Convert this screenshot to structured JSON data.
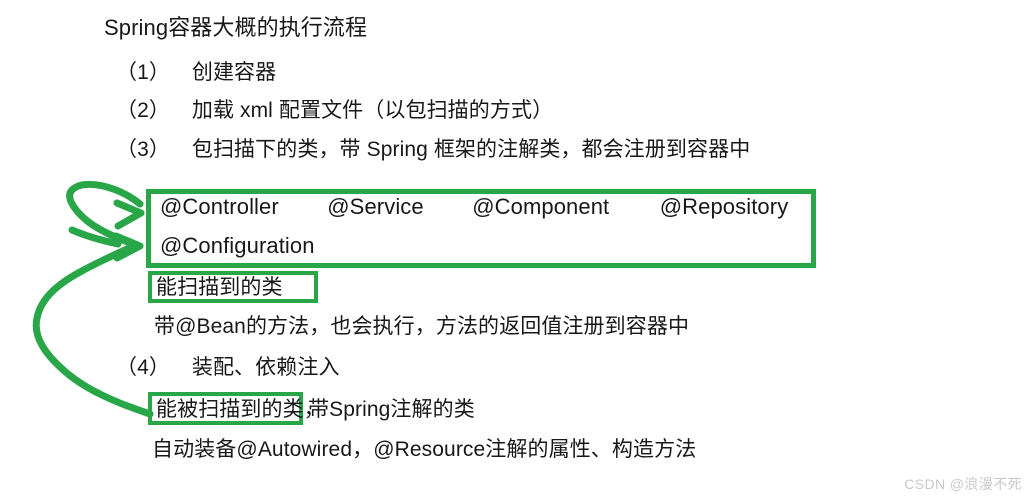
{
  "document": {
    "title": "Spring容器大概的执行流程",
    "steps": [
      {
        "marker": "（1）",
        "text": "创建容器"
      },
      {
        "marker": "（2）",
        "text": "加载 xml 配置文件（以包扫描的方式）"
      },
      {
        "marker": "（3）",
        "text": "包扫描下的类，带 Spring 框架的注解类，都会注册到容器中"
      },
      {
        "marker": "（4）",
        "text": "装配、依赖注入"
      }
    ],
    "annotation_box": {
      "row1": [
        "@Controller",
        "@Service",
        "@Component",
        "@Repository"
      ],
      "row2": [
        "@Configuration"
      ]
    },
    "highlight_1": "能扫描到的类",
    "sub_note_1": "带@Bean的方法，也会执行，方法的返回值注册到容器中",
    "highlight_2": "能被扫描到的类，",
    "after_highlight_2": "带Spring注解的类",
    "sub_note_2": "自动装备@Autowired，@Resource注解的属性、构造方法"
  },
  "watermark": {
    "text": "CSDN @浪漫不死"
  },
  "colors": {
    "accent_green": "#28a648",
    "text": "#18181b",
    "watermark": "#c9c9c9",
    "background": "#ffffff"
  }
}
